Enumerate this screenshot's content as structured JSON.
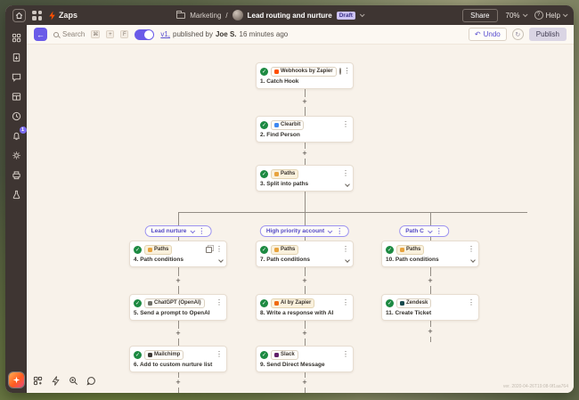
{
  "ui": {
    "kebab": "⋮",
    "check": "✓",
    "back": "←",
    "undo_arrow": "↶",
    "redo_arrow": "↻",
    "help_q": "?",
    "add_step": "+"
  },
  "topbar": {
    "product": "Zaps",
    "breadcrumb_folder": "Marketing",
    "breadcrumb_sep": "/",
    "zap_name": "Lead routing and nurture",
    "status_badge": "Draft",
    "share_label": "Share",
    "zoom_level": "70%",
    "help_label": "Help"
  },
  "sidebar": {
    "badge_count": "1"
  },
  "toolbar": {
    "search_placeholder": "Search",
    "keys": [
      "⌘",
      "+",
      "F"
    ],
    "version_link": "v1,",
    "published_text": "published by",
    "author": "Joe S.",
    "time_ago": "16 minutes ago",
    "undo_label": "Undo",
    "publish_label": "Publish"
  },
  "canvas": {
    "branches": [
      {
        "label": "Lead nurture"
      },
      {
        "label": "High priority account"
      },
      {
        "label": "Path C"
      }
    ],
    "nodes": [
      {
        "app": "Webhooks by Zapier",
        "title": "1. Catch Hook",
        "color": "#ff4f00"
      },
      {
        "app": "Clearbit",
        "title": "2. Find Person",
        "color": "#3d88f2"
      },
      {
        "app": "Paths",
        "title": "3. Split into paths",
        "color": "#e8a33d"
      },
      {
        "app": "Paths",
        "title": "4. Path conditions",
        "color": "#e8a33d"
      },
      {
        "app": "ChatGPT (OpenAI)",
        "title": "5. Send a prompt to OpenAI",
        "color": "#6f6f68"
      },
      {
        "app": "Mailchimp",
        "title": "6. Add to custom nurture list",
        "color": "#3e3a35"
      },
      {
        "app": "Paths",
        "title": "7. Path conditions",
        "color": "#e8a33d"
      },
      {
        "app": "AI by Zapier",
        "title": "8. Write a response with AI",
        "color": "#f06a12"
      },
      {
        "app": "Slack",
        "title": "9. Send Direct Message",
        "color": "#611f69"
      },
      {
        "app": "Paths",
        "title": "10. Path conditions",
        "color": "#e8a33d"
      },
      {
        "app": "Zendesk",
        "title": "11. Create Ticket",
        "color": "#17494d"
      }
    ],
    "version_watermark": "ver. 2020-04-26T19:08-9f1aa764"
  }
}
